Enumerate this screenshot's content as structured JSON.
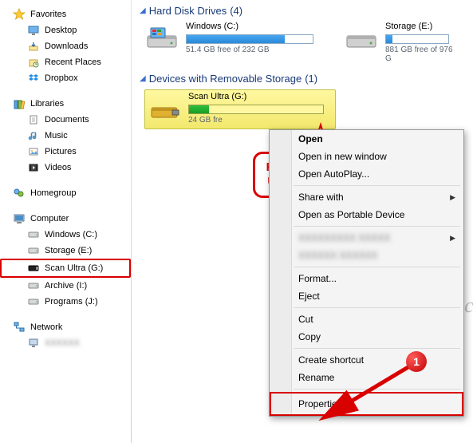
{
  "sidebar": {
    "favorites": {
      "label": "Favorites",
      "items": [
        "Desktop",
        "Downloads",
        "Recent Places",
        "Dropbox"
      ]
    },
    "libraries": {
      "label": "Libraries",
      "items": [
        "Documents",
        "Music",
        "Pictures",
        "Videos"
      ]
    },
    "homegroup": {
      "label": "Homegroup"
    },
    "computer": {
      "label": "Computer",
      "items": [
        "Windows (C:)",
        "Storage (E:)",
        "Scan Ultra (G:)",
        "Archive (I:)",
        "Programs (J:)"
      ]
    },
    "network": {
      "label": "Network"
    }
  },
  "sections": {
    "hdd": {
      "title": "Hard Disk Drives",
      "count": "(4)"
    },
    "removable": {
      "title": "Devices with Removable Storage",
      "count": "(1)"
    }
  },
  "drives": {
    "c": {
      "name": "Windows (C:)",
      "free": "51.4 GB free of 232 GB"
    },
    "e": {
      "name": "Storage (E:)",
      "free": "881 GB free of 976 G"
    },
    "g": {
      "name": "Scan Ultra (G:)",
      "free": "24    GB fre"
    }
  },
  "context": {
    "open": "Open",
    "newwin": "Open in new window",
    "autoplay": "Open AutoPlay...",
    "share": "Share with",
    "portable": "Open as Portable Device",
    "format": "Format...",
    "eject": "Eject",
    "cut": "Cut",
    "copy": "Copy",
    "shortcut": "Create shortcut",
    "rename": "Rename",
    "props": "Properties"
  },
  "callout": {
    "line1": "Right-click",
    "line2": "USB Drive"
  },
  "badge": "1",
  "watermark": "iCareAll.com"
}
